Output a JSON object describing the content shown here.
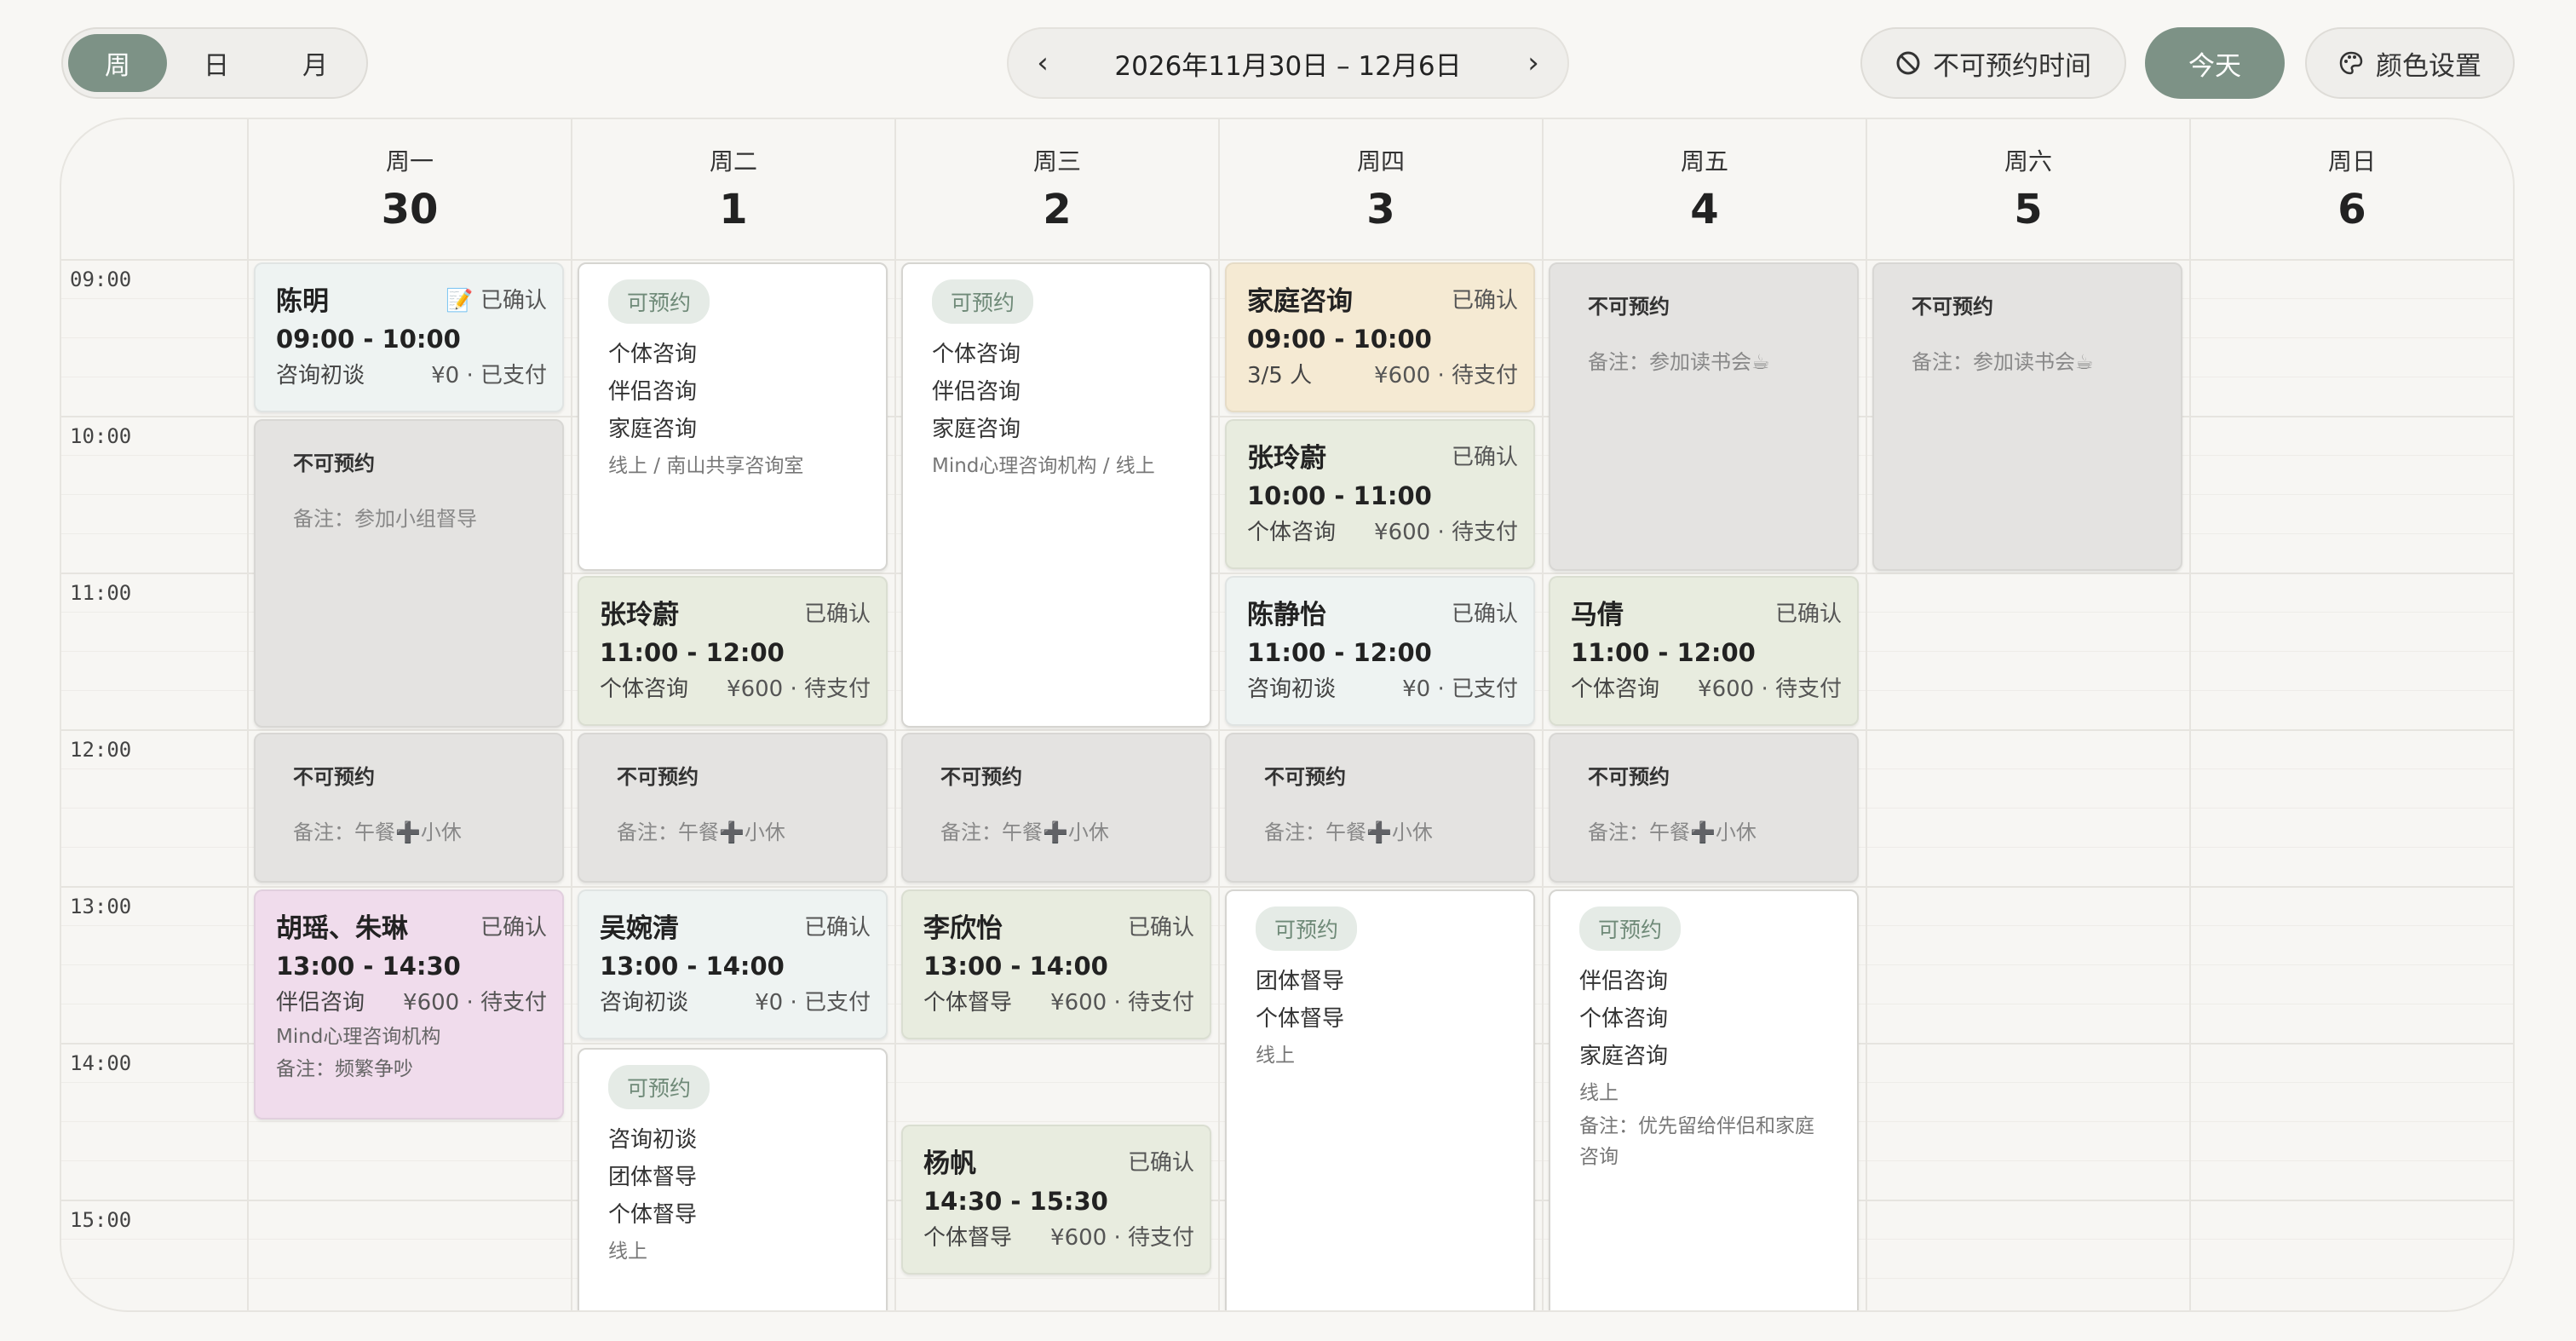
{
  "view_switch": {
    "week": "周",
    "day": "日",
    "month": "月",
    "active": "week"
  },
  "date_nav": {
    "prev_icon": "chevron-left-icon",
    "range": "2026年11月30日 – 12月6日",
    "next_icon": "chevron-right-icon"
  },
  "actions": {
    "unavailable": "不可预约时间",
    "today": "今天",
    "colors": "颜色设置"
  },
  "days": [
    {
      "weekday": "周一",
      "date": "30"
    },
    {
      "weekday": "周二",
      "date": "1"
    },
    {
      "weekday": "周三",
      "date": "2"
    },
    {
      "weekday": "周四",
      "date": "3"
    },
    {
      "weekday": "周五",
      "date": "4"
    },
    {
      "weekday": "周六",
      "date": "5"
    },
    {
      "weekday": "周日",
      "date": "6"
    }
  ],
  "hours": [
    "09:00",
    "10:00",
    "11:00",
    "12:00",
    "13:00",
    "14:00",
    "15:00"
  ],
  "events": {
    "mon_chen": {
      "name": "陈明",
      "status": "📝 已确认",
      "time": "09:00 - 10:00",
      "type": "咨询初谈",
      "price": "¥0 · 已支付"
    },
    "mon_block1": {
      "title": "不可预约",
      "note": "备注：参加小组督导"
    },
    "mon_block2": {
      "title": "不可预约",
      "note": "备注：午餐➕小休"
    },
    "mon_hu": {
      "name": "胡瑶、朱琳",
      "status": "已确认",
      "time": "13:00 - 14:30",
      "type": "伴侣咨询",
      "price": "¥600 · 待支付",
      "org": "Mind心理咨询机构",
      "note": "备注：频繁争吵"
    },
    "tue_avail1": {
      "badge": "可预约",
      "services": [
        "个体咨询",
        "伴侣咨询",
        "家庭咨询"
      ],
      "location": "线上 / 南山共享咨询室"
    },
    "tue_zhang": {
      "name": "张玲蔚",
      "status": "已确认",
      "time": "11:00 - 12:00",
      "type": "个体咨询",
      "price": "¥600 · 待支付"
    },
    "tue_block": {
      "title": "不可预约",
      "note": "备注：午餐➕小休"
    },
    "tue_wu": {
      "name": "吴婉清",
      "status": "已确认",
      "time": "13:00 - 14:00",
      "type": "咨询初谈",
      "price": "¥0 · 已支付"
    },
    "tue_avail2": {
      "badge": "可预约",
      "services": [
        "咨询初谈",
        "团体督导",
        "个体督导"
      ],
      "location": "线上"
    },
    "wed_avail1": {
      "badge": "可预约",
      "services": [
        "个体咨询",
        "伴侣咨询",
        "家庭咨询"
      ],
      "location": "Mind心理咨询机构 / 线上"
    },
    "wed_block": {
      "title": "不可预约",
      "note": "备注：午餐➕小休"
    },
    "wed_li": {
      "name": "李欣怡",
      "status": "已确认",
      "time": "13:00 - 14:00",
      "type": "个体督导",
      "price": "¥600 · 待支付"
    },
    "wed_yang": {
      "name": "杨帆",
      "status": "已确认",
      "time": "14:30 - 15:30",
      "type": "个体督导",
      "price": "¥600 · 待支付"
    },
    "thu_family": {
      "name": "家庭咨询",
      "status": "已确认",
      "time": "09:00 - 10:00",
      "type": "3/5 人",
      "price": "¥600 · 待支付"
    },
    "thu_zhang": {
      "name": "张玲蔚",
      "status": "已确认",
      "time": "10:00 - 11:00",
      "type": "个体咨询",
      "price": "¥600 · 待支付"
    },
    "thu_chen": {
      "name": "陈静怡",
      "status": "已确认",
      "time": "11:00 - 12:00",
      "type": "咨询初谈",
      "price": "¥0 · 已支付"
    },
    "thu_block": {
      "title": "不可预约",
      "note": "备注：午餐➕小休"
    },
    "thu_avail": {
      "badge": "可预约",
      "services": [
        "团体督导",
        "个体督导"
      ],
      "location": "线上"
    },
    "fri_block1": {
      "title": "不可预约",
      "note": "备注：参加读书会☕"
    },
    "fri_ma": {
      "name": "马倩",
      "status": "已确认",
      "time": "11:00 - 12:00",
      "type": "个体咨询",
      "price": "¥600 · 待支付"
    },
    "fri_block2": {
      "title": "不可预约",
      "note": "备注：午餐➕小休"
    },
    "fri_avail": {
      "badge": "可预约",
      "services": [
        "伴侣咨询",
        "个体咨询",
        "家庭咨询"
      ],
      "location": "线上",
      "note": "备注：优先留给伴侣和家庭咨询"
    },
    "sat_block": {
      "title": "不可预约",
      "note": "备注：参加读书会☕"
    }
  },
  "colors": {
    "accent": "#7d9286",
    "mint": "#eef3f2",
    "sage": "#e8ecdf",
    "beige": "#f5ead3",
    "pink": "#f0dcec",
    "blocked": "#e4e3e1"
  }
}
